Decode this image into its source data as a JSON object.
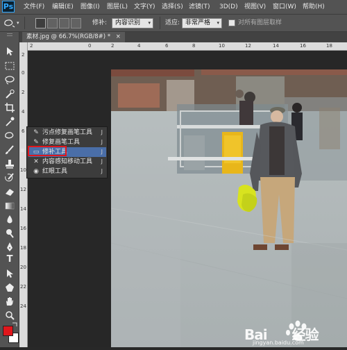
{
  "app": {
    "logo": "Ps"
  },
  "menu_items": [
    "文件(F)",
    "编辑(E)",
    "图像(I)",
    "图层(L)",
    "文字(Y)",
    "选择(S)",
    "滤镜(T)",
    "3D(D)",
    "视图(V)",
    "窗口(W)",
    "帮助(H)"
  ],
  "options_bar": {
    "repair_label": "修补:",
    "repair_mode": "内容识别",
    "adapt_label": "适应:",
    "adapt_mode": "非常严格",
    "sample_all_label": "对所有图层取样"
  },
  "document": {
    "tab_title": "素材.jpg @ 66.7%(RGB/8#) *",
    "tab_close": "×"
  },
  "rulers": {
    "horizontal": [
      "2",
      "0",
      "2",
      "4",
      "6",
      "8",
      "10",
      "12",
      "14",
      "16",
      "18"
    ],
    "vertical": [
      "2",
      "0",
      "2",
      "4",
      "6",
      "8",
      "10",
      "12",
      "14",
      "16",
      "18",
      "20",
      "22",
      "24"
    ]
  },
  "tool_flyout": {
    "items": [
      {
        "label": "污点修复画笔工具",
        "shortcut": "J",
        "icon": "spot-healing-brush-icon"
      },
      {
        "label": "修复画笔工具",
        "shortcut": "J",
        "icon": "healing-brush-icon"
      },
      {
        "label": "修补工具",
        "shortcut": "J",
        "icon": "patch-tool-icon",
        "selected": true
      },
      {
        "label": "内容感知移动工具",
        "shortcut": "J",
        "icon": "content-aware-move-icon"
      },
      {
        "label": "红眼工具",
        "shortcut": "J",
        "icon": "red-eye-icon"
      }
    ]
  },
  "colors": {
    "foreground": "#e0161b",
    "background": "#ffffff",
    "highlight": "#e0161b",
    "selection": "#4a6ea8"
  },
  "watermark": {
    "text": "Bai 经验",
    "url": "jingyan.baidu.com"
  }
}
